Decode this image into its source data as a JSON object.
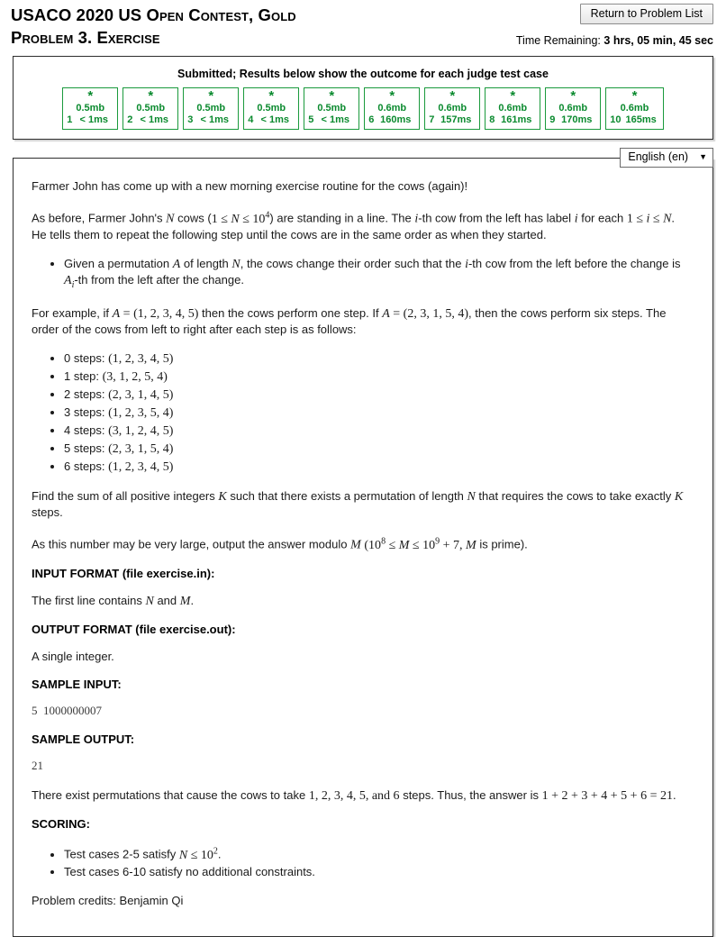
{
  "header": {
    "title_line1": "USACO 2020 US Open Contest, Gold",
    "title_line2": "Problem 3. Exercise",
    "return_button": "Return to Problem List",
    "time_label": "Time Remaining:",
    "time_value": "3 hrs, 05 min, 45 sec"
  },
  "results": {
    "heading": "Submitted; Results below show the outcome for each judge test case",
    "status_icon": "star-icon",
    "green": "#0a8a2e",
    "cases": [
      {
        "num": "1",
        "status": "*",
        "memory": "0.5mb",
        "time": "< 1ms"
      },
      {
        "num": "2",
        "status": "*",
        "memory": "0.5mb",
        "time": "< 1ms"
      },
      {
        "num": "3",
        "status": "*",
        "memory": "0.5mb",
        "time": "< 1ms"
      },
      {
        "num": "4",
        "status": "*",
        "memory": "0.5mb",
        "time": "< 1ms"
      },
      {
        "num": "5",
        "status": "*",
        "memory": "0.5mb",
        "time": "< 1ms"
      },
      {
        "num": "6",
        "status": "*",
        "memory": "0.6mb",
        "time": "160ms"
      },
      {
        "num": "7",
        "status": "*",
        "memory": "0.6mb",
        "time": "157ms"
      },
      {
        "num": "8",
        "status": "*",
        "memory": "0.6mb",
        "time": "161ms"
      },
      {
        "num": "9",
        "status": "*",
        "memory": "0.6mb",
        "time": "170ms"
      },
      {
        "num": "10",
        "status": "*",
        "memory": "0.6mb",
        "time": "165ms"
      }
    ]
  },
  "language": {
    "selected": "English (en)",
    "caret": "▼"
  },
  "problem": {
    "intro": "Farmer John has come up with a new morning exercise routine for the cows (again)!",
    "para_setup_a": "As before, Farmer John's",
    "para_setup_b": "cows (",
    "para_setup_c": ") are standing in a line. The",
    "para_setup_d": "-th cow from the left has label",
    "para_setup_e": "for each",
    "para_setup_f": ".",
    "para_setup_g": "He tells them to repeat the following step until the cows are in the same order as when they started.",
    "bullet_rule_a": "Given a permutation",
    "bullet_rule_b": "of length",
    "bullet_rule_c": ", the cows change their order such that the",
    "bullet_rule_d": "-th cow from the left before the change is",
    "bullet_rule_e": "-th from the left after the change.",
    "example_a": "For example, if",
    "example_b": "then the cows perform one step. If",
    "example_c": ", then the cows perform six steps. The order of the cows from left to right after each step is as follows:",
    "steps": [
      {
        "label": "0 steps:",
        "perm": "(1, 2, 3, 4, 5)"
      },
      {
        "label": "1 step:",
        "perm": "(3, 1, 2, 5, 4)"
      },
      {
        "label": "2 steps:",
        "perm": "(2, 3, 1, 4, 5)"
      },
      {
        "label": "3 steps:",
        "perm": "(1, 2, 3, 5, 4)"
      },
      {
        "label": "4 steps:",
        "perm": "(3, 1, 2, 4, 5)"
      },
      {
        "label": "5 steps:",
        "perm": "(2, 3, 1, 5, 4)"
      },
      {
        "label": "6 steps:",
        "perm": "(1, 2, 3, 4, 5)"
      }
    ],
    "find_a": "Find the sum of all positive integers",
    "find_b": "such that there exists a permutation of length",
    "find_c": "that requires the cows to take exactly",
    "find_d": "steps.",
    "modulo_a": "As this number may be very large, output the answer modulo",
    "modulo_b": "is prime).",
    "input_format_heading": "INPUT FORMAT (file exercise.in):",
    "input_format_body_a": "The first line contains",
    "input_format_body_b": "and",
    "input_format_body_c": ".",
    "output_format_heading": "OUTPUT FORMAT (file exercise.out):",
    "output_format_body": "A single integer.",
    "sample_input_heading": "SAMPLE INPUT:",
    "sample_input": "5  1000000007",
    "sample_output_heading": "SAMPLE OUTPUT:",
    "sample_output": "21",
    "explanation_a": "There exist permutations that cause the cows to take",
    "explanation_b": "steps. Thus, the answer is",
    "explanation_c": ".",
    "explanation_steps": "1, 2, 3, 4, 5, and 6",
    "explanation_sum": "1 + 2 + 3 + 4 + 5 + 6 = 21",
    "scoring_heading": "SCORING:",
    "scoring": [
      {
        "prefix": "Test cases 2-5 satisfy",
        "math": "N ≤ 10",
        "exp": "2",
        "suffix": "."
      },
      {
        "prefix": "Test cases 6-10 satisfy no additional constraints.",
        "math": "",
        "exp": "",
        "suffix": ""
      }
    ],
    "credits": "Problem credits: Benjamin Qi"
  }
}
